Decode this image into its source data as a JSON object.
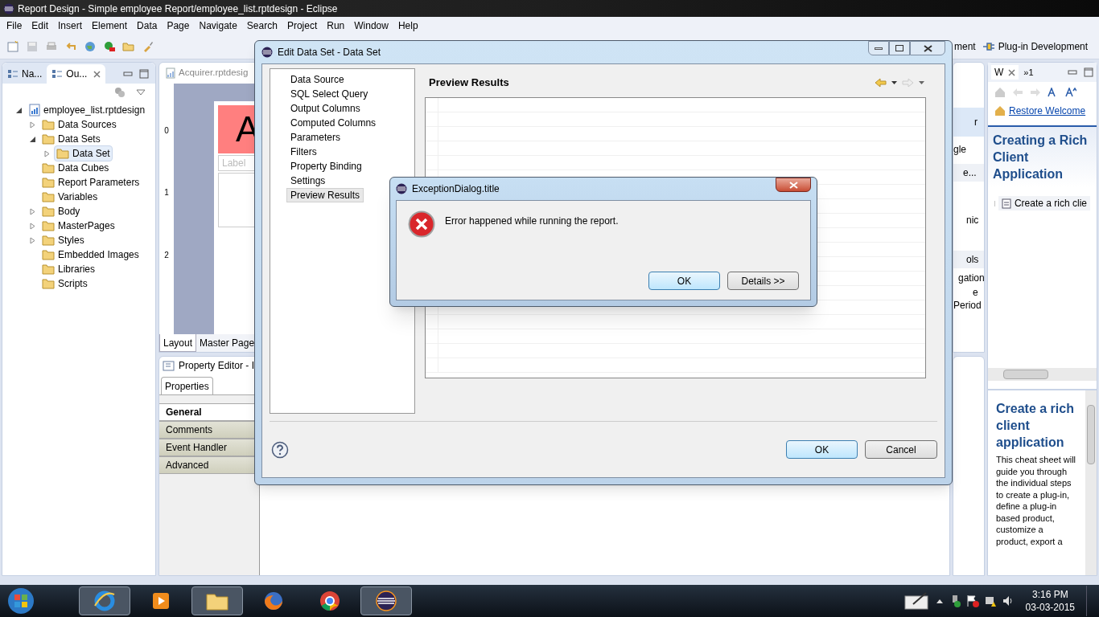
{
  "window": {
    "title": "Report Design - Simple employee Report/employee_list.rptdesign - Eclipse"
  },
  "menu": [
    "File",
    "Edit",
    "Insert",
    "Element",
    "Data",
    "Page",
    "Navigate",
    "Search",
    "Project",
    "Run",
    "Window",
    "Help"
  ],
  "perspectives": [
    {
      "label": "ment",
      "selected": false
    },
    {
      "label": "Plug-in Development",
      "selected": false
    }
  ],
  "outline_view": {
    "tabs": [
      {
        "label": "Na...",
        "selected": false
      },
      {
        "label": "Ou...",
        "selected": true
      }
    ],
    "tree": {
      "label": "employee_list.rptdesign",
      "expanded": true,
      "children": [
        {
          "label": "Data Sources",
          "expanded": false,
          "selected": false
        },
        {
          "label": "Data Sets",
          "expanded": true,
          "selected": false,
          "children": [
            {
              "label": "Data Set",
              "expanded": false,
              "selected": true
            }
          ]
        },
        {
          "label": "Data Cubes",
          "selected": false
        },
        {
          "label": "Report Parameters",
          "selected": false
        },
        {
          "label": "Variables",
          "selected": false
        },
        {
          "label": "Body",
          "expanded": false,
          "selected": false
        },
        {
          "label": "MasterPages",
          "expanded": false,
          "selected": false
        },
        {
          "label": "Styles",
          "expanded": false,
          "selected": false
        },
        {
          "label": "Embedded Images",
          "selected": false
        },
        {
          "label": "Libraries",
          "selected": false
        },
        {
          "label": "Scripts",
          "selected": false
        }
      ]
    }
  },
  "editor": {
    "tab": "Acquirer.rptdesig",
    "ruler_marks": [
      "0",
      "1",
      "2"
    ],
    "title_glyph": "A",
    "label_placeholder": "Label",
    "bottom_tabs": [
      {
        "label": "Layout",
        "selected": true
      },
      {
        "label": "Master Page",
        "selected": false
      }
    ]
  },
  "property_editor": {
    "title": "Property Editor - I",
    "tab": "Properties",
    "categories": [
      {
        "label": "General",
        "selected": true
      },
      {
        "label": "Comments",
        "selected": false
      },
      {
        "label": "Event Handler",
        "selected": false
      },
      {
        "label": "Advanced",
        "selected": false
      }
    ]
  },
  "side_fragments": [
    "r",
    "gle",
    "e...",
    "nic",
    "ols",
    "gation",
    "e",
    "Period"
  ],
  "welcome": {
    "tabs": [
      "W",
      "»1"
    ],
    "link": "Restore Welcome",
    "heading": "Creating a Rich Client Application",
    "item": "Create a rich clie",
    "cheat_sheet": {
      "title": "Create a rich client application",
      "body": "This cheat sheet will guide you through the individual steps to create a plug-in, define a plug-in based product, customize a product, export a"
    }
  },
  "data_set_dialog": {
    "title": "Edit Data Set - Data Set",
    "nav": [
      {
        "label": "Data Source",
        "selected": false
      },
      {
        "label": "SQL Select Query",
        "selected": false
      },
      {
        "label": "Output Columns",
        "selected": false
      },
      {
        "label": "Computed Columns",
        "selected": false
      },
      {
        "label": "Parameters",
        "selected": false
      },
      {
        "label": "Filters",
        "selected": false
      },
      {
        "label": "Property Binding",
        "selected": false
      },
      {
        "label": "Settings",
        "selected": false
      },
      {
        "label": "Preview Results",
        "selected": true
      }
    ],
    "heading": "Preview Results",
    "buttons": [
      "OK",
      "Cancel"
    ]
  },
  "exception_dialog": {
    "title": "ExceptionDialog.title",
    "message": "Error happened while running the report.",
    "buttons": [
      "OK",
      "Details >>"
    ]
  },
  "taskbar": {
    "apps": [
      {
        "kind": "browser-e",
        "running": true
      },
      {
        "kind": "media",
        "running": false
      },
      {
        "kind": "folder",
        "running": true
      },
      {
        "kind": "fox",
        "running": false
      },
      {
        "kind": "chrome",
        "running": false
      },
      {
        "kind": "eclipse",
        "running": true
      }
    ],
    "time": "3:16 PM",
    "date": "03-03-2015"
  }
}
